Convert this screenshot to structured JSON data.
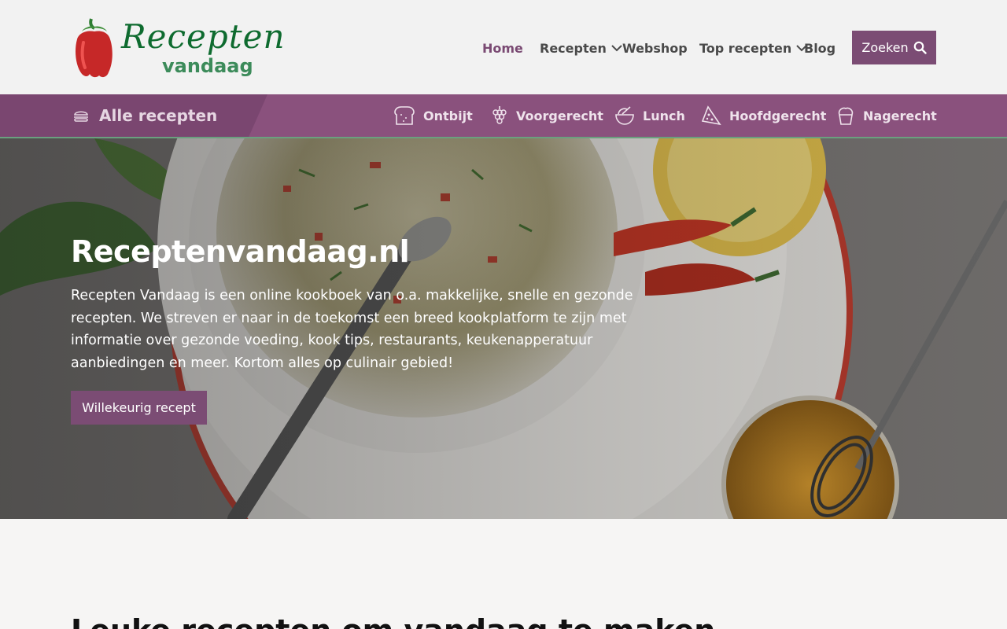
{
  "brand": {
    "logo_line1": "Recepten",
    "logo_line2": "vandaag",
    "colors": {
      "primary": "#7b4c74",
      "catbar": "#8a517d",
      "green": "#0e6b2f"
    }
  },
  "nav": {
    "items": [
      {
        "label": "Home",
        "active": true,
        "has_dropdown": false
      },
      {
        "label": "Recepten",
        "active": false,
        "has_dropdown": true
      },
      {
        "label": "Webshop",
        "active": false,
        "has_dropdown": false
      },
      {
        "label": "Top recepten",
        "active": false,
        "has_dropdown": true
      },
      {
        "label": "Blog",
        "active": false,
        "has_dropdown": false
      }
    ],
    "search_label": "Zoeken",
    "search_icon": "search-icon"
  },
  "categories": {
    "all_label": "Alle recepten",
    "all_icon": "burger-icon",
    "items": [
      {
        "label": "Ontbijt",
        "icon": "bread-icon"
      },
      {
        "label": "Voorgerecht",
        "icon": "grapes-icon"
      },
      {
        "label": "Lunch",
        "icon": "bowl-icon"
      },
      {
        "label": "Hoofdgerecht",
        "icon": "pizza-icon"
      },
      {
        "label": "Nagerecht",
        "icon": "cupcake-icon"
      }
    ]
  },
  "hero": {
    "title": "Receptenvandaag.nl",
    "text": "Recepten Vandaag is een online kookboek van o.a. makkelijke, snelle en gezonde recepten. We streven er naar in de toekomst een breed kookplatform te zijn met informatie over gezonde voeding, kook tips, restaurants, keukenapperatuur aanbiedingen en meer. Kortom alles op culinair gebied!",
    "button_label": "Willekeurig recept"
  },
  "section": {
    "title": "Leuke recepten om vandaag te maken"
  }
}
